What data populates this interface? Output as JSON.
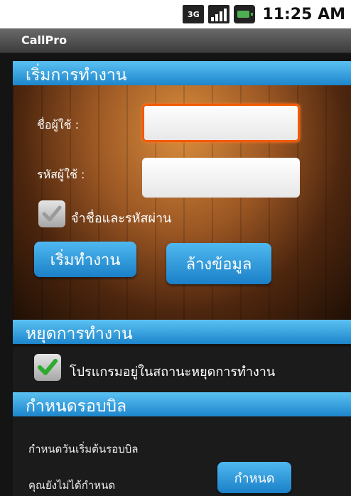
{
  "status_bar": {
    "network": "3G",
    "time": "11:25 AM"
  },
  "app_bar": {
    "title": "CallPro"
  },
  "start_section": {
    "title": "เริ่มการทำงาน",
    "username_label": "ชื่อผู้ใช้ :",
    "username_value": "",
    "password_label": "รหัสผู้ใช้ :",
    "password_value": "",
    "remember_label": "จำชื่อและรหัสผ่าน",
    "remember_checked": true,
    "start_button": "เริ่มทำงาน",
    "clear_button": "ล้างข้อมูล"
  },
  "stop_section": {
    "title": "หยุดการทำงาน",
    "stopped_label": "โปรแกรมอยู่ในสถานะหยุดการทำงาน",
    "stopped_checked": true
  },
  "billing_section": {
    "title": "กำหนดรอบบิล",
    "start_day_label": "กำหนดวันเริ่มต้นรอบบิล",
    "status_text": "คุณยังไม่ได้กำหนด",
    "set_button": "กำหนด"
  }
}
